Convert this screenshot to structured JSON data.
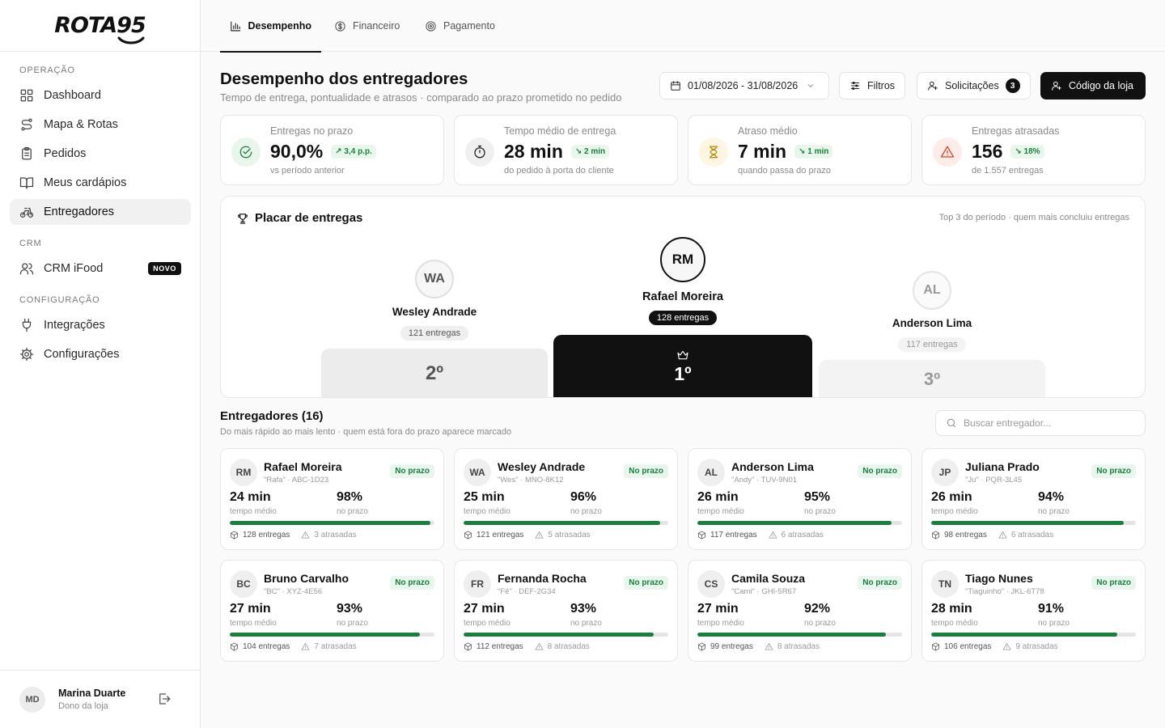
{
  "brand": {
    "logo_text": "ROTA95"
  },
  "sidebar": {
    "sections": [
      "OPERAÇÃO",
      "CRM",
      "CONFIGURAÇÃO"
    ],
    "items": [
      {
        "label": "Dashboard",
        "icon": "grid-icon"
      },
      {
        "label": "Mapa & Rotas",
        "icon": "route-icon"
      },
      {
        "label": "Pedidos",
        "icon": "clipboard-icon"
      },
      {
        "label": "Meus cardápios",
        "icon": "book-icon"
      },
      {
        "label": "Entregadores",
        "icon": "bike-icon",
        "active": true
      },
      {
        "label": "CRM iFood",
        "icon": "users-icon",
        "badge": "NOVO"
      },
      {
        "label": "Integrações",
        "icon": "plug-icon"
      },
      {
        "label": "Configurações",
        "icon": "gear-icon"
      }
    ],
    "user": {
      "initials": "MD",
      "name": "Marina Duarte",
      "role": "Dono da loja"
    }
  },
  "tabs": [
    {
      "label": "Desempenho",
      "active": true
    },
    {
      "label": "Financeiro"
    },
    {
      "label": "Pagamento"
    }
  ],
  "header": {
    "title": "Desempenho dos entregadores",
    "subtitle": "Tempo de entrega, pontualidade e atrasos · comparado ao prazo prometido no pedido",
    "date_range": "01/08/2026 - 31/08/2026",
    "filters_label": "Filtros",
    "requests_label": "Solicitações",
    "requests_count": "3",
    "store_code_label": "Código da loja"
  },
  "stats": [
    {
      "label": "Entregas no prazo",
      "value": "90,0%",
      "delta": "3,4 p.p.",
      "sub": "vs período anterior",
      "icon": "check-circle-icon"
    },
    {
      "label": "Tempo médio de entrega",
      "value": "28 min",
      "delta": "2 min",
      "sub": "do pedido à porta do cliente",
      "icon": "timer-icon"
    },
    {
      "label": "Atraso médio",
      "value": "7 min",
      "delta": "1 min",
      "sub": "quando passa do prazo",
      "icon": "hourglass-icon"
    },
    {
      "label": "Entregas atrasadas",
      "value": "156",
      "delta": "18%",
      "sub": "de 1.557 entregas",
      "icon": "alert-triangle-icon"
    }
  ],
  "podium": {
    "title": "Placar de entregas",
    "note": "Top 3 do período · quem mais concluiu entregas",
    "first": {
      "initials": "RM",
      "name": "Rafael Moreira",
      "count": "128 entregas",
      "place": "1º"
    },
    "second": {
      "initials": "WA",
      "name": "Wesley Andrade",
      "count": "121 entregas",
      "place": "2º"
    },
    "third": {
      "initials": "AL",
      "name": "Anderson Lima",
      "count": "117 entregas",
      "place": "3º"
    }
  },
  "drivers": {
    "title": "Entregadores (16)",
    "subtitle": "Do mais rápido ao mais lento · quem está fora do prazo aparece marcado",
    "search_placeholder": "Buscar entregador...",
    "time_label": "tempo médio",
    "pct_label": "no prazo",
    "list": [
      {
        "initials": "RM",
        "name": "Rafael Moreira",
        "meta": "\"Rafa\" · ABC-1D23",
        "status": "No prazo",
        "time": "24 min",
        "pct": "98%",
        "ontime_ratio": 0.98,
        "deliveries": "128 entregas",
        "late": "3 atrasadas"
      },
      {
        "initials": "WA",
        "name": "Wesley Andrade",
        "meta": "\"Wes\" · MNO-8K12",
        "status": "No prazo",
        "time": "25 min",
        "pct": "96%",
        "ontime_ratio": 0.96,
        "deliveries": "121 entregas",
        "late": "5 atrasadas"
      },
      {
        "initials": "AL",
        "name": "Anderson Lima",
        "meta": "\"Andy\" · TUV-9N01",
        "status": "No prazo",
        "time": "26 min",
        "pct": "95%",
        "ontime_ratio": 0.95,
        "deliveries": "117 entregas",
        "late": "6 atrasadas"
      },
      {
        "initials": "JP",
        "name": "Juliana Prado",
        "meta": "\"Ju\" · PQR-3L45",
        "status": "No prazo",
        "time": "26 min",
        "pct": "94%",
        "ontime_ratio": 0.94,
        "deliveries": "98 entregas",
        "late": "6 atrasadas"
      },
      {
        "initials": "BC",
        "name": "Bruno Carvalho",
        "meta": "\"BC\" · XYZ-4E56",
        "status": "No prazo",
        "time": "27 min",
        "pct": "93%",
        "ontime_ratio": 0.93,
        "deliveries": "104 entregas",
        "late": "7 atrasadas"
      },
      {
        "initials": "FR",
        "name": "Fernanda Rocha",
        "meta": "\"Fê\" · DEF-2G34",
        "status": "No prazo",
        "time": "27 min",
        "pct": "93%",
        "ontime_ratio": 0.93,
        "deliveries": "112 entregas",
        "late": "8 atrasadas"
      },
      {
        "initials": "CS",
        "name": "Camila Souza",
        "meta": "\"Cami\" · GHI-5R67",
        "status": "No prazo",
        "time": "27 min",
        "pct": "92%",
        "ontime_ratio": 0.92,
        "deliveries": "99 entregas",
        "late": "8 atrasadas"
      },
      {
        "initials": "TN",
        "name": "Tiago Nunes",
        "meta": "\"Tiaguinho\" · JKL-6T78",
        "status": "No prazo",
        "time": "28 min",
        "pct": "91%",
        "ontime_ratio": 0.91,
        "deliveries": "106 entregas",
        "late": "9 atrasadas"
      }
    ]
  },
  "colors": {
    "accent": "#111111",
    "success": "#1a7f3c",
    "success_bg": "#e8f6ec",
    "warning": "#b98300",
    "danger": "#d6452b"
  }
}
